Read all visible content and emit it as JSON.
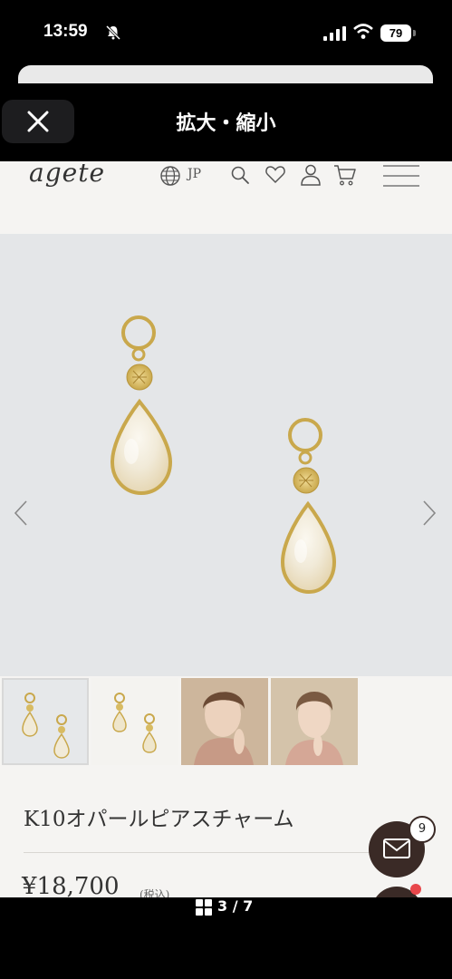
{
  "status_bar": {
    "time": "13:59",
    "battery": "79"
  },
  "viewer": {
    "title": "拡大・縮小",
    "page_counter": "3 / 7"
  },
  "site": {
    "logo": "agete",
    "lang": "JP"
  },
  "product": {
    "name": "K10オパールピアスチャーム",
    "price": "¥18,700",
    "tax": "(税込)",
    "thumbnail_count": 4,
    "active_image": 1
  },
  "mail": {
    "badge": "9"
  },
  "colors": {
    "accent": "#3a2a26",
    "notify": "#e8474b",
    "gold": "#c9a84c"
  }
}
